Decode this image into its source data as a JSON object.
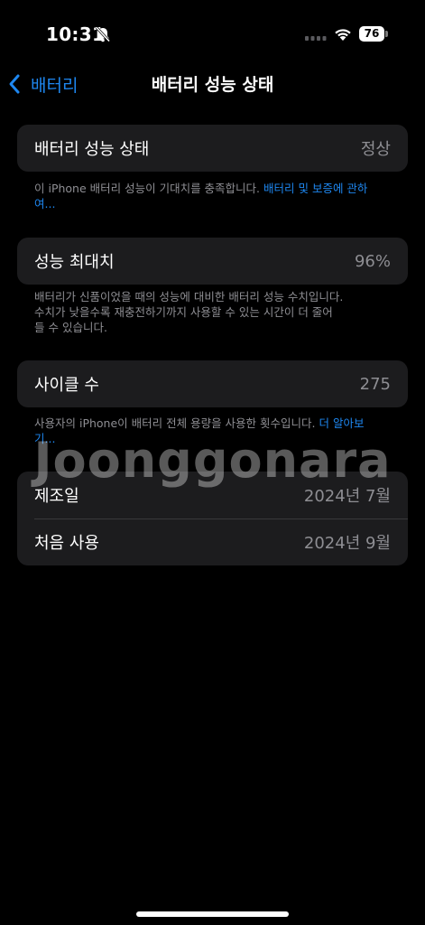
{
  "status_bar": {
    "time": "10:31",
    "battery_level": "76"
  },
  "nav": {
    "back_label": "배터리",
    "title": "배터리 성능 상태"
  },
  "health": {
    "label": "배터리 성능 상태",
    "value": "정상",
    "note": "이 iPhone 배터리 성능이 기대치를 충족합니다. ",
    "note_link": "배터리 및 보증에 관하여..."
  },
  "max_capacity": {
    "label": "성능 최대치",
    "value": "96%",
    "note_lines": [
      "배터리가 신품이었을 때의 성능에 대비한 배터리 성능 수치입니다.",
      "수치가 낮을수록 재충전하기까지 사용할 수 있는 시간이 더 줄어",
      "들 수 있습니다."
    ]
  },
  "cycle_count": {
    "label": "사이클 수",
    "value": "275",
    "note": "사용자의 iPhone이 배터리 전체 용량을 사용한 횟수입니다. ",
    "note_link": "더 알아보기..."
  },
  "dates": {
    "manufactured_label": "제조일",
    "manufactured_value": "2024년 7월",
    "first_use_label": "처음 사용",
    "first_use_value": "2024년 9월"
  },
  "watermark": "Joonggonara",
  "icons": [
    "bell-slash-icon",
    "signal-icon",
    "wifi-icon",
    "battery-icon",
    "chevron-left-icon"
  ]
}
